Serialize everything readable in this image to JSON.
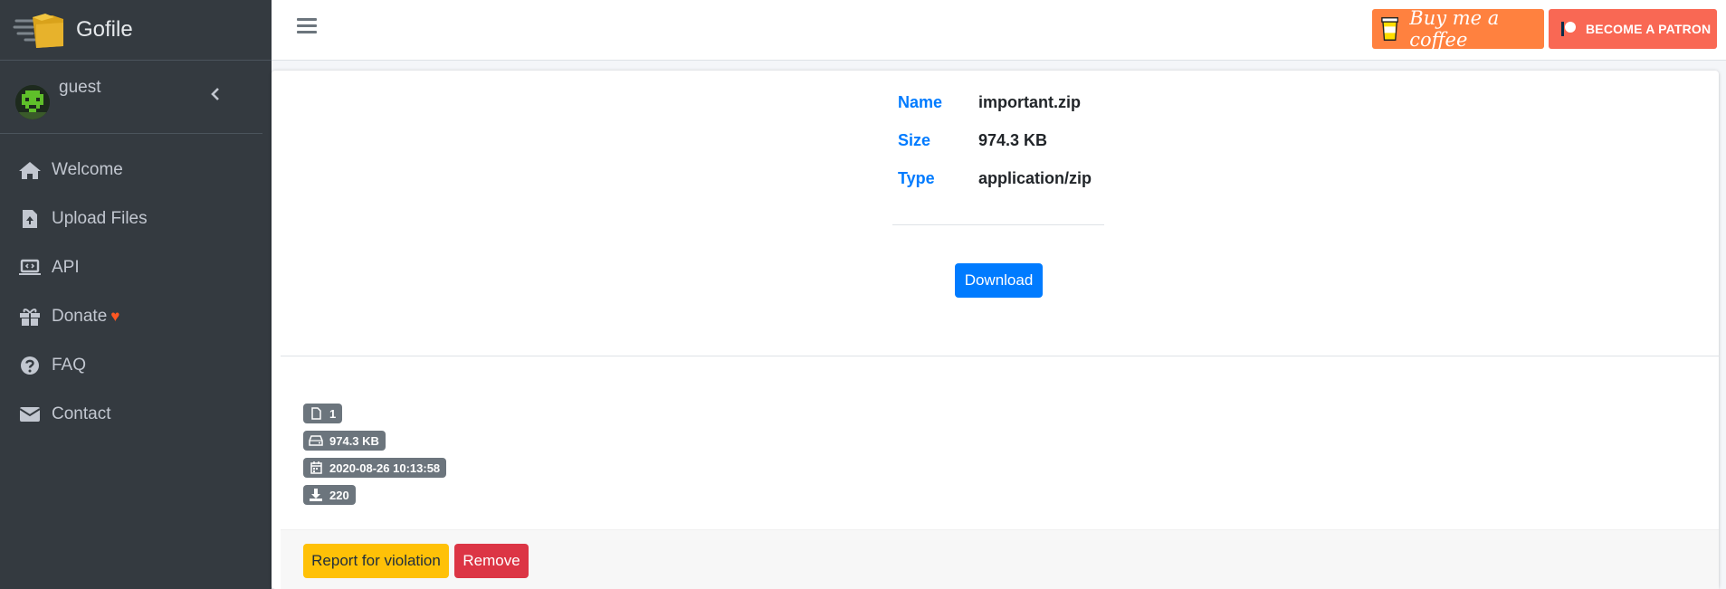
{
  "brand": {
    "name": "Gofile",
    "logo_icon": "folder-speed-icon"
  },
  "user": {
    "name": "guest",
    "avatar_icon": "pixel-avatar-icon",
    "collapse_icon": "chevron-left-icon"
  },
  "sidebar": {
    "items": [
      {
        "label": "Welcome",
        "icon": "home-icon"
      },
      {
        "label": "Upload Files",
        "icon": "file-upload-icon"
      },
      {
        "label": "API",
        "icon": "laptop-code-icon"
      },
      {
        "label": "Donate",
        "icon": "gift-icon",
        "extra_icon": "heart-icon"
      },
      {
        "label": "FAQ",
        "icon": "question-circle-icon"
      },
      {
        "label": "Contact",
        "icon": "envelope-icon"
      }
    ]
  },
  "topbar": {
    "menu_icon": "hamburger-icon",
    "bmc_label": "Buy me a coffee",
    "patreon_label": "BECOME A PATRON"
  },
  "file": {
    "name_label": "Name",
    "name_value": "important.zip",
    "size_label": "Size",
    "size_value": "974.3 KB",
    "type_label": "Type",
    "type_value": "application/zip",
    "download_label": "Download"
  },
  "stats": {
    "file_count": "1",
    "total_size": "974.3 KB",
    "created": "2020-08-26 10:13:58",
    "downloads": "220"
  },
  "actions": {
    "report_label": "Report for violation",
    "remove_label": "Remove"
  },
  "colors": {
    "sidebar_bg": "#343a40",
    "primary": "#007bff",
    "warning": "#ffc107",
    "danger": "#dc3545",
    "badge": "#6c757d",
    "bmc": "#ff813f",
    "patreon": "#f96854",
    "heart": "#ff5722"
  }
}
